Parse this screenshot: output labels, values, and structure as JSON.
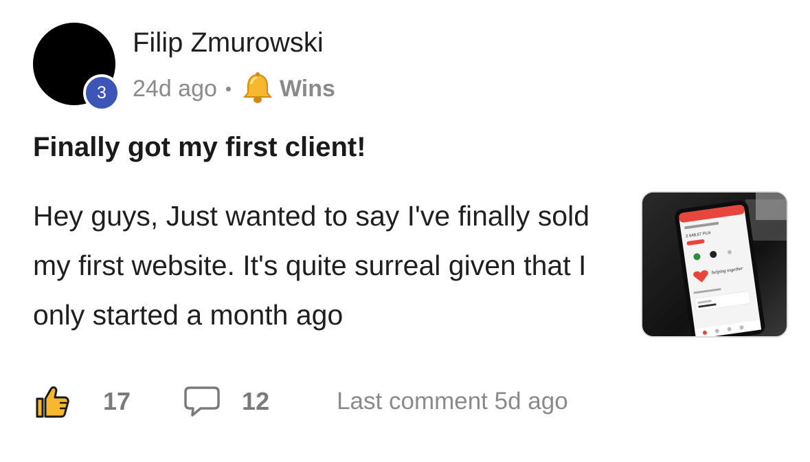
{
  "author": {
    "name": "Filip Zmurowski",
    "level": "3",
    "avatar_color": "#000000",
    "level_badge_color": "#3c55b7"
  },
  "meta": {
    "time_ago": "24d ago",
    "separator": "•",
    "category_icon": "bell-icon",
    "category": "Wins"
  },
  "post": {
    "title": "Finally got my first client!",
    "body": "Hey guys, Just wanted to say I've finally sold my first website. It's quite surreal given that I only started a month ago",
    "thumbnail_alt": "phone-screenshot",
    "thumbnail_text": {
      "amount": "2 648,67 PLN",
      "slogan": "helping together"
    }
  },
  "footer": {
    "like_icon": "thumbs-up-icon",
    "likes": "17",
    "comment_icon": "comment-bubble-icon",
    "comments": "12",
    "last_comment": "Last comment 5d ago"
  }
}
